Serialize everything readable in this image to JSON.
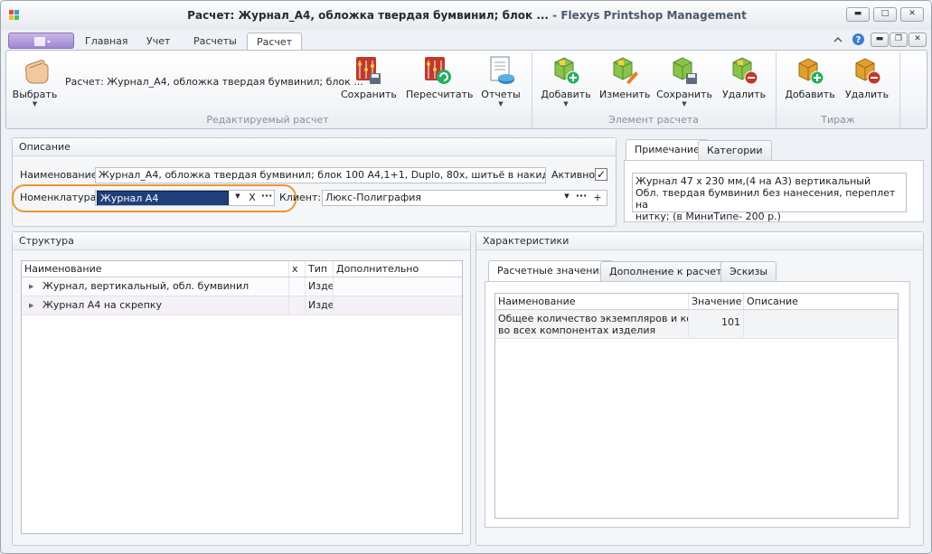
{
  "window": {
    "title": "Расчет: Журнал_А4, обложка твердая бумвинил; блок ...",
    "app_name": " - Flexys Printshop Management",
    "controls": {
      "minimize": "▬",
      "maximize": "□",
      "close": "✕"
    }
  },
  "ribbon_tabs": [
    "Главная",
    "Учет",
    "Расчеты",
    "Расчет"
  ],
  "ribbon_right_icons": [
    "chevron-up-icon",
    "help-icon",
    "restore-icon",
    "close-icon"
  ],
  "ribbon": {
    "choose_label": "Выбрать",
    "calc_label": "Расчет: Журнал_А4, обложка твердая бумвинил; блок ...",
    "group1": {
      "label": "Редактируемый расчет",
      "save": "Сохранить",
      "recalc": "Пересчитать",
      "reports": "Отчеты"
    },
    "group2": {
      "label": "Элемент расчета",
      "add": "Добавить",
      "edit": "Изменить",
      "save": "Сохранить",
      "delete": "Удалить"
    },
    "group3": {
      "label": "Тираж",
      "add": "Добавить",
      "delete": "Удалить"
    }
  },
  "description": {
    "header": "Описание",
    "name_label": "Наименование:",
    "name_value": "Журнал_А4, обложка твердая бумвинил; блок 100 А4,1+1, Duplo, 80x, шитьё в накидку",
    "active_label": "Активно",
    "active_checked": true,
    "nomenclature_label": "Номенклатура:",
    "nomenclature_value": "Журнал А4",
    "client_label": "Клиент:",
    "client_value": "Люкс-Полиграфия",
    "highlight_color": "#f0962e"
  },
  "notes": {
    "tabs": [
      "Примечание",
      "Категории"
    ],
    "text_lines": [
      "Журнал 47 х 230 мм,(4 на А3) вертикальный",
      "Обл. твердая бумвинил без нанесения, переплет на",
      "нитку;  (в МиниТипе- 200 р.)"
    ]
  },
  "structure": {
    "header": "Структура",
    "columns": [
      "Наименование",
      "x",
      "Тип",
      "Дополнительно"
    ],
    "rows": [
      {
        "name": "Журнал, вертикальный, обл. бумвинил",
        "x": "",
        "type": "Изде",
        "extra": ""
      },
      {
        "name": "Журнал А4 на скрепку",
        "x": "",
        "type": "Изде",
        "extra": ""
      }
    ]
  },
  "characteristics": {
    "header": "Характеристики",
    "tabs": [
      "Расчетные значения",
      "Дополнение к расчету",
      "Эскизы"
    ],
    "columns": [
      "Наименование",
      "Значение",
      "Описание"
    ],
    "rows": [
      {
        "name_line1": "Общее количество экземпляров и копий",
        "name_line2": "во всех компонентах изделия",
        "value": "101",
        "desc": ""
      }
    ]
  },
  "symbols": {
    "dropdown": "▼",
    "clear": "X",
    "ellipsis": "···",
    "plus": "+",
    "expand": "▶",
    "check": "✓"
  }
}
